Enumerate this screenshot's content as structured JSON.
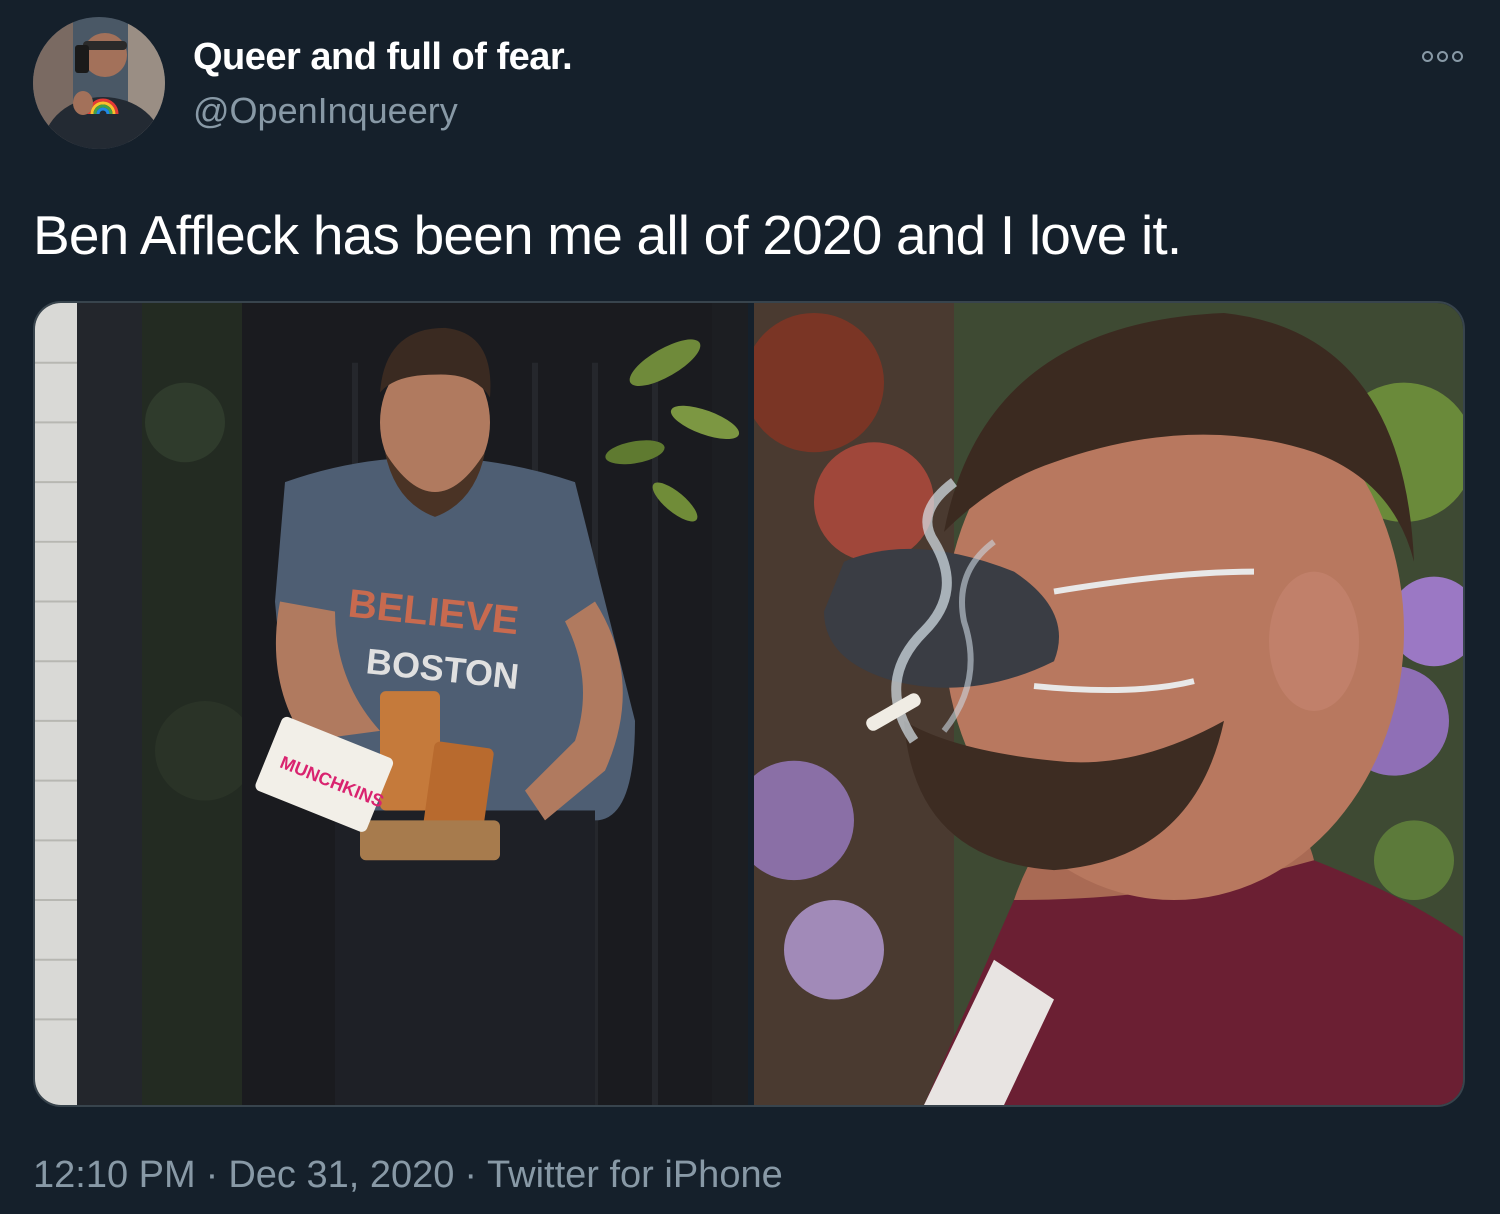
{
  "author": {
    "display_name": "Queer and full of fear.",
    "handle": "@OpenInqueery",
    "avatar_icon": "profile-photo"
  },
  "more_menu_icon": "more-options-icon",
  "tweet": {
    "text": "Ben Affleck has been me all of 2020 and I love it."
  },
  "media": [
    {
      "name": "photo-man-carrying-coffee",
      "shirt_text_1": "BELIEVE",
      "shirt_text_2": "BOSTON",
      "box_text": "MUNCHKINS"
    },
    {
      "name": "photo-man-smoking-in-mask"
    }
  ],
  "meta": {
    "time": "12:10 PM",
    "separator": "·",
    "date": "Dec 31, 2020",
    "source": "Twitter for iPhone"
  },
  "colors": {
    "background": "#15202b",
    "primary_text": "#ffffff",
    "secondary_text": "#8899a6",
    "border": "#38444d"
  }
}
